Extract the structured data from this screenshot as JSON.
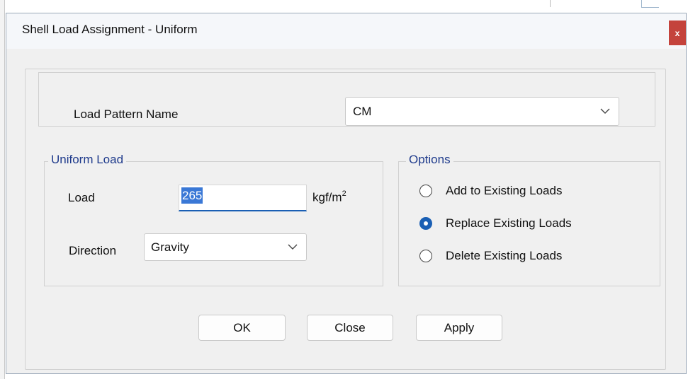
{
  "window": {
    "title": "Shell Load Assignment - Uniform",
    "close_glyph": "x"
  },
  "load_pattern": {
    "label": "Load Pattern Name",
    "selected": "CM",
    "icon": "chevron-down-icon"
  },
  "uniform_load": {
    "legend": "Uniform Load",
    "load_label": "Load",
    "load_value": "265",
    "unit_base": "kgf/m",
    "unit_exp": "2",
    "direction_label": "Direction",
    "direction_selected": "Gravity"
  },
  "options": {
    "legend": "Options",
    "items": [
      {
        "label": "Add to Existing Loads",
        "selected": false
      },
      {
        "label": "Replace Existing Loads",
        "selected": true
      },
      {
        "label": "Delete Existing Loads",
        "selected": false
      }
    ]
  },
  "buttons": {
    "ok": "OK",
    "close": "Close",
    "apply": "Apply"
  },
  "colors": {
    "accent": "#1a5fb4",
    "legend_text": "#1f3b8c",
    "close_button": "#c4433c",
    "selection": "#3a78d6"
  }
}
